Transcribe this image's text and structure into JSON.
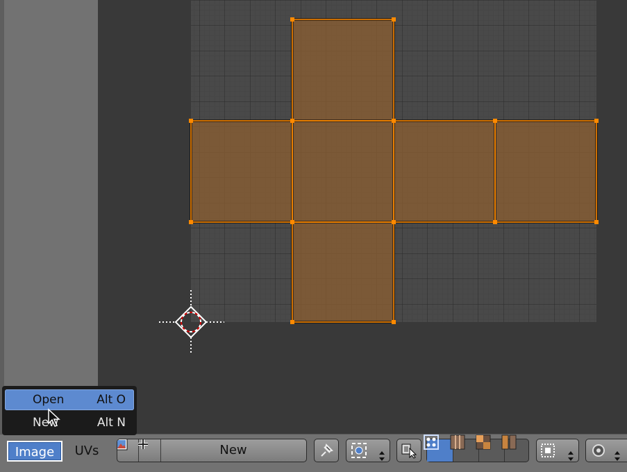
{
  "header": {
    "image_menu": "Image",
    "uvs_menu": "UVs",
    "image_selector": {
      "new_label": "New"
    }
  },
  "dropdown": {
    "items": [
      {
        "label": "Open",
        "shortcut": "Alt O"
      },
      {
        "label": "New",
        "shortcut": "Alt N"
      }
    ]
  },
  "colors": {
    "face_fill": "#6b5038",
    "edge_selected": "#ff8c00",
    "vertex_selected": "#ff8c00",
    "menu_highlight": "#5d8ad0",
    "header_bg": "#727272"
  },
  "icons": [
    "image-browse-icon",
    "plus-icon",
    "pin-icon",
    "pivot-icon",
    "sync-selection-icon",
    "vertex-select-icon",
    "edge-select-icon",
    "face-select-icon",
    "island-select-icon",
    "snap-icon",
    "proportional-edit-icon",
    "cursor-crosshair-icon",
    "mouse-pointer-icon"
  ]
}
